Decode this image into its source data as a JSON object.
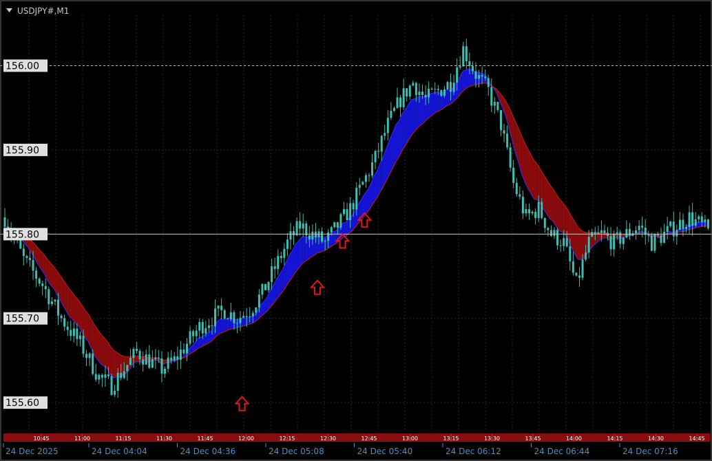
{
  "window": {
    "symbol_label": "USDJPY#,M1"
  },
  "colors": {
    "background": "#000000",
    "grid": "#2a2a2a",
    "candle": "#3fbfb1",
    "ribbon_up": "#1414d2",
    "ribbon_down": "#8a0b0b",
    "ribbon_edge_fast": "#3030ff",
    "ribbon_edge_slow": "#cc1a1a",
    "arrow": "#e01818",
    "price_line": "#c8c8c8",
    "dotted_level": "#d8c070",
    "axis_label_bg": "#e0e0e0",
    "time_band": "#8b0c0c"
  },
  "chart_data": {
    "type": "candlestick",
    "symbol": "USDJPY#",
    "timeframe": "M1",
    "ylim": [
      155.565,
      156.06
    ],
    "y_ticks": [
      "156.00",
      "155.90",
      "155.80",
      "155.70",
      "155.60"
    ],
    "current_price": 155.8,
    "dotted_level": 156.0,
    "x_tick_labels": [
      "24 Dec 2025",
      "24 Dec 04:04",
      "24 Dec 04:36",
      "24 Dec 05:08",
      "24 Dec 05:40",
      "24 Dec 06:12",
      "24 Dec 06:44",
      "24 Dec 07:16"
    ],
    "time_band_labels": [
      "10:45",
      "11:00",
      "11:15",
      "11:30",
      "11:45",
      "12:00",
      "12:15",
      "12:30",
      "12:45",
      "13:00",
      "13:15",
      "13:30",
      "13:45",
      "14:00",
      "14:15",
      "14:30",
      "14:45"
    ],
    "price_path": [
      [
        0,
        155.82
      ],
      [
        6,
        155.77
      ],
      [
        12,
        155.74
      ],
      [
        18,
        155.7
      ],
      [
        24,
        155.67
      ],
      [
        30,
        155.63
      ],
      [
        34,
        155.62
      ],
      [
        38,
        155.64
      ],
      [
        42,
        155.66
      ],
      [
        46,
        155.65
      ],
      [
        50,
        155.64
      ],
      [
        54,
        155.65
      ],
      [
        58,
        155.67
      ],
      [
        62,
        155.69
      ],
      [
        66,
        155.7
      ],
      [
        70,
        155.71
      ],
      [
        74,
        155.7
      ],
      [
        78,
        155.71
      ],
      [
        82,
        155.73
      ],
      [
        86,
        155.76
      ],
      [
        90,
        155.79
      ],
      [
        94,
        155.81
      ],
      [
        98,
        155.8
      ],
      [
        102,
        155.79
      ],
      [
        106,
        155.81
      ],
      [
        110,
        155.83
      ],
      [
        114,
        155.86
      ],
      [
        118,
        155.89
      ],
      [
        122,
        155.93
      ],
      [
        126,
        155.96
      ],
      [
        130,
        155.98
      ],
      [
        134,
        155.96
      ],
      [
        138,
        155.97
      ],
      [
        142,
        155.98
      ],
      [
        146,
        156.02
      ],
      [
        150,
        155.99
      ],
      [
        154,
        155.97
      ],
      [
        158,
        155.93
      ],
      [
        162,
        155.86
      ],
      [
        166,
        155.82
      ],
      [
        170,
        155.83
      ],
      [
        174,
        155.8
      ],
      [
        178,
        155.79
      ],
      [
        182,
        155.74
      ],
      [
        186,
        155.79
      ],
      [
        190,
        155.8
      ],
      [
        194,
        155.79
      ],
      [
        198,
        155.8
      ],
      [
        202,
        155.81
      ],
      [
        206,
        155.79
      ],
      [
        210,
        155.8
      ],
      [
        214,
        155.81
      ],
      [
        218,
        155.82
      ],
      [
        222,
        155.81
      ],
      [
        225,
        155.8
      ]
    ],
    "bars_total": 225,
    "signals": [
      {
        "type": "buy-arrow",
        "bar": 76,
        "price": 155.607
      },
      {
        "type": "buy-arrow",
        "bar": 100,
        "price": 155.745
      },
      {
        "type": "buy-arrow",
        "bar": 108,
        "price": 155.8
      },
      {
        "type": "buy-arrow",
        "bar": 115,
        "price": 155.825
      }
    ]
  }
}
